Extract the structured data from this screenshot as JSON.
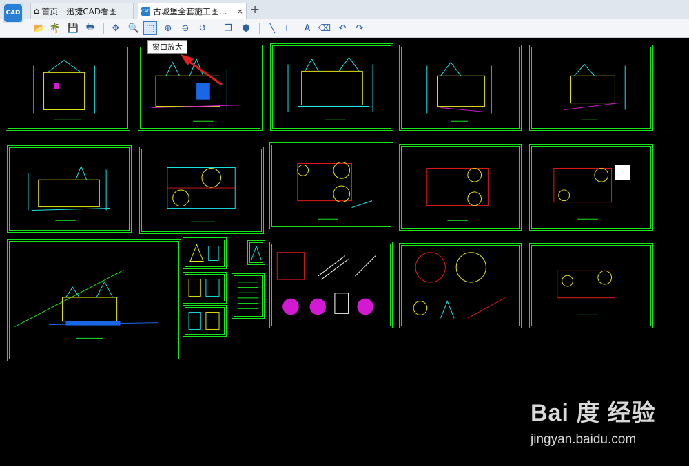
{
  "app": {
    "logo_text": "CAD"
  },
  "tabs": [
    {
      "label": "首页 - 迅捷CAD看图",
      "icon": "home-icon"
    },
    {
      "label": "古城堡全套施工图...",
      "icon": "cad-file-icon",
      "close": "×"
    }
  ],
  "new_tab_symbol": "+",
  "toolbar": [
    {
      "name": "open-icon",
      "glyph": "📂"
    },
    {
      "name": "palm-icon",
      "glyph": "🌴"
    },
    {
      "name": "save-icon",
      "glyph": "💾"
    },
    {
      "name": "print-icon",
      "glyph": "🖶"
    },
    {
      "name": "pan-icon",
      "glyph": "✥"
    },
    {
      "name": "zoom-realtime-icon",
      "glyph": "🔍"
    },
    {
      "name": "zoom-window-icon",
      "glyph": "⬚"
    },
    {
      "name": "zoom-in-icon",
      "glyph": "⊕"
    },
    {
      "name": "zoom-out-icon",
      "glyph": "⊖"
    },
    {
      "name": "zoom-previous-icon",
      "glyph": "↺"
    },
    {
      "name": "layers-icon",
      "glyph": "❒"
    },
    {
      "name": "3d-view-icon",
      "glyph": "⬢"
    },
    {
      "name": "line-icon",
      "glyph": "╲"
    },
    {
      "name": "dimension-icon",
      "glyph": "⊢"
    },
    {
      "name": "text-icon",
      "glyph": "A"
    },
    {
      "name": "eraser-icon",
      "glyph": "⌫"
    },
    {
      "name": "undo-icon",
      "glyph": "↶"
    },
    {
      "name": "redo-icon",
      "glyph": "↷"
    }
  ],
  "tooltip": "窗口放大",
  "colors": {
    "accent": "#3b7bd1",
    "sheet_border": "#19e619",
    "arrow": "#e02020"
  },
  "watermark": {
    "logo": "Bai 度 经验",
    "url": "jingyan.baidu.com"
  }
}
